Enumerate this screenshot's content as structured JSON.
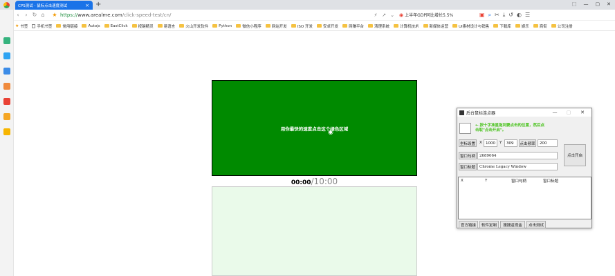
{
  "browser": {
    "tab_title": "CPS测试 - 鼠标点击速度测试",
    "tab_close": "×",
    "new_tab": "+",
    "window_controls": [
      "⬚",
      "—",
      "▢",
      "✕"
    ],
    "url_protocol": "https://",
    "url_host": "www.arealme.com",
    "url_path": "/click-speed-test/cn/",
    "search_text": "上半年GDP同比增长5.5%"
  },
  "bookmarks": [
    {
      "label": "书签",
      "type": "star"
    },
    {
      "label": "手机书签",
      "type": "page"
    },
    {
      "label": "常用链接",
      "type": "folder"
    },
    {
      "label": "Autojs",
      "type": "folder"
    },
    {
      "label": "EastClick",
      "type": "folder"
    },
    {
      "label": "按键精灵",
      "type": "folder"
    },
    {
      "label": "易语言",
      "type": "folder"
    },
    {
      "label": "火山开发软件",
      "type": "folder"
    },
    {
      "label": "Python",
      "type": "folder"
    },
    {
      "label": "微信小程序",
      "type": "folder"
    },
    {
      "label": "网站开发",
      "type": "folder"
    },
    {
      "label": "ISO 开发",
      "type": "folder"
    },
    {
      "label": "安卓开发",
      "type": "folder"
    },
    {
      "label": "网赚平台",
      "type": "folder"
    },
    {
      "label": "清理系统",
      "type": "folder"
    },
    {
      "label": "计算机技术",
      "type": "folder"
    },
    {
      "label": "新媒体运营",
      "type": "folder"
    },
    {
      "label": "UI素材设计与销售",
      "type": "folder"
    },
    {
      "label": "下载库",
      "type": "folder"
    },
    {
      "label": "娱乐",
      "type": "folder"
    },
    {
      "label": "商街",
      "type": "folder"
    },
    {
      "label": "公司注册",
      "type": "folder"
    }
  ],
  "test": {
    "click_area_text": "用你最快的速度点击这个绿色区域",
    "time_current": "00:00",
    "time_total": "/10:00"
  },
  "dialog": {
    "title": "后台鼠标连点器",
    "hint_line1": "← 按十字准星拖到要点击的位置，然后点",
    "hint_line2": "击取\"点击开启\"。",
    "coord_button": "坐标设置",
    "x_label": "X",
    "x_value": "1000",
    "y_label": "Y",
    "y_value": "309",
    "freq_button": "点击频率",
    "freq_value": "200",
    "handle_button": "窗口句柄",
    "handle_value": "2689064",
    "wintitle_button": "窗口标题",
    "wintitle_value": "Chrome Legacy Window",
    "start_button": "点击开启",
    "columns": [
      "X",
      "Y",
      "窗口句柄",
      "窗口标题"
    ],
    "bottom_buttons": [
      "官方链接",
      "软件定制",
      "搜搜返现金",
      "点击测试"
    ]
  }
}
